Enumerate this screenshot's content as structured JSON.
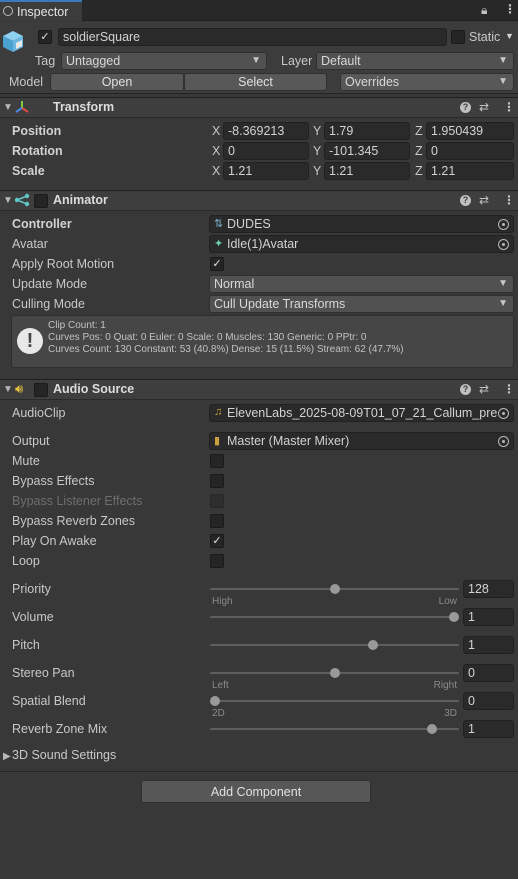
{
  "tab": {
    "label": "Inspector"
  },
  "header": {
    "object_name": "soldierSquare",
    "static_label": "Static",
    "tag_label": "Tag",
    "tag_value": "Untagged",
    "layer_label": "Layer",
    "layer_value": "Default",
    "model_label": "Model",
    "open_label": "Open",
    "select_label": "Select",
    "overrides_label": "Overrides"
  },
  "transform": {
    "title": "Transform",
    "position_label": "Position",
    "rotation_label": "Rotation",
    "scale_label": "Scale",
    "axes": [
      "X",
      "Y",
      "Z"
    ],
    "position": [
      "-8.369213",
      "1.79",
      "1.950439"
    ],
    "rotation": [
      "0",
      "-101.345",
      "0"
    ],
    "scale": [
      "1.21",
      "1.21",
      "1.21"
    ]
  },
  "animator": {
    "title": "Animator",
    "controller_label": "Controller",
    "controller_value": "DUDES",
    "avatar_label": "Avatar",
    "avatar_value": "Idle(1)Avatar",
    "apply_root_motion_label": "Apply Root Motion",
    "apply_root_motion": true,
    "update_mode_label": "Update Mode",
    "update_mode_value": "Normal",
    "culling_mode_label": "Culling Mode",
    "culling_mode_value": "Cull Update Transforms",
    "info_lines": [
      "Clip Count: 1",
      "Curves Pos: 0 Quat: 0 Euler: 0 Scale: 0 Muscles: 130 Generic: 0 PPtr: 0",
      "Curves Count: 130 Constant: 53 (40.8%) Dense: 15 (11.5%) Stream: 62 (47.7%)"
    ]
  },
  "audio": {
    "title": "Audio Source",
    "clip_label": "AudioClip",
    "clip_value": "ElevenLabs_2025-08-09T01_07_21_Callum_pre",
    "output_label": "Output",
    "output_value": "Master (Master Mixer)",
    "toggles": [
      {
        "label": "Mute",
        "checked": false,
        "disabled": false
      },
      {
        "label": "Bypass Effects",
        "checked": false,
        "disabled": false
      },
      {
        "label": "Bypass Listener Effects",
        "checked": false,
        "disabled": true
      },
      {
        "label": "Bypass Reverb Zones",
        "checked": false,
        "disabled": false
      },
      {
        "label": "Play On Awake",
        "checked": true,
        "disabled": false
      },
      {
        "label": "Loop",
        "checked": false,
        "disabled": false
      }
    ],
    "sliders": [
      {
        "label": "Priority",
        "value": "128",
        "fraction": 0.5,
        "left_cap": "High",
        "right_cap": "Low"
      },
      {
        "label": "Volume",
        "value": "1",
        "fraction": 1.0,
        "left_cap": "",
        "right_cap": ""
      },
      {
        "label": "Pitch",
        "value": "1",
        "fraction": 0.66,
        "left_cap": "",
        "right_cap": ""
      },
      {
        "label": "Stereo Pan",
        "value": "0",
        "fraction": 0.5,
        "left_cap": "Left",
        "right_cap": "Right"
      },
      {
        "label": "Spatial Blend",
        "value": "0",
        "fraction": 0.0,
        "left_cap": "2D",
        "right_cap": "3D"
      },
      {
        "label": "Reverb Zone Mix",
        "value": "1",
        "fraction": 0.91,
        "left_cap": "",
        "right_cap": ""
      }
    ],
    "sound_settings_label": "3D Sound Settings"
  },
  "add_component_label": "Add Component",
  "colors": {
    "background": "#383838",
    "tab_accent": "#3a79bb",
    "field_bg": "#2a2a2a",
    "dropdown_bg": "#515151"
  }
}
